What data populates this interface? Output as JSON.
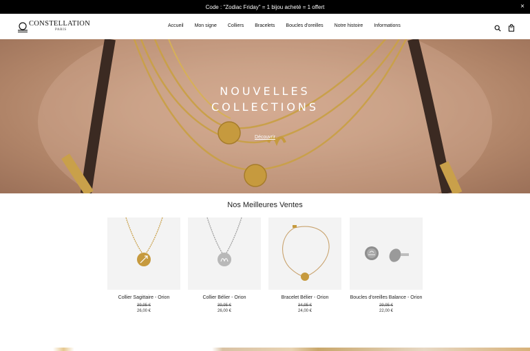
{
  "announcement": {
    "text": "Code : \"Zodiac Friday\" = 1 bijou acheté = 1 offert",
    "close": "×"
  },
  "header": {
    "brand": "CONSTELLATION",
    "sub": "PARIS",
    "nav": [
      "Accueil",
      "Mon signe",
      "Colliers",
      "Bracelets",
      "Boucles d'oreilles",
      "Notre histoire",
      "Informations"
    ],
    "icons": [
      "search-icon",
      "bag-icon"
    ]
  },
  "hero": {
    "title_line1": "NOUVELLES",
    "title_line2": "COLLECTIONS",
    "link": "Découvrir"
  },
  "bestsellers": {
    "title": "Nos Meilleures Ventes",
    "products": [
      {
        "name": "Collier Sagittaire - Orion",
        "old_price": "39,95 €",
        "price": "26,00 €"
      },
      {
        "name": "Collier Bélier - Orion",
        "old_price": "39,95 €",
        "price": "26,00 €"
      },
      {
        "name": "Bracelet Bélier - Orion",
        "old_price": "34,95 €",
        "price": "24,00 €"
      },
      {
        "name": "Boucles d'oreilles Balance - Orion",
        "old_price": "29,95 €",
        "price": "22,00 €"
      }
    ]
  },
  "colors": {
    "topbar": "#000000",
    "gold": "#c9a04a",
    "silver": "#b8b8b8"
  }
}
